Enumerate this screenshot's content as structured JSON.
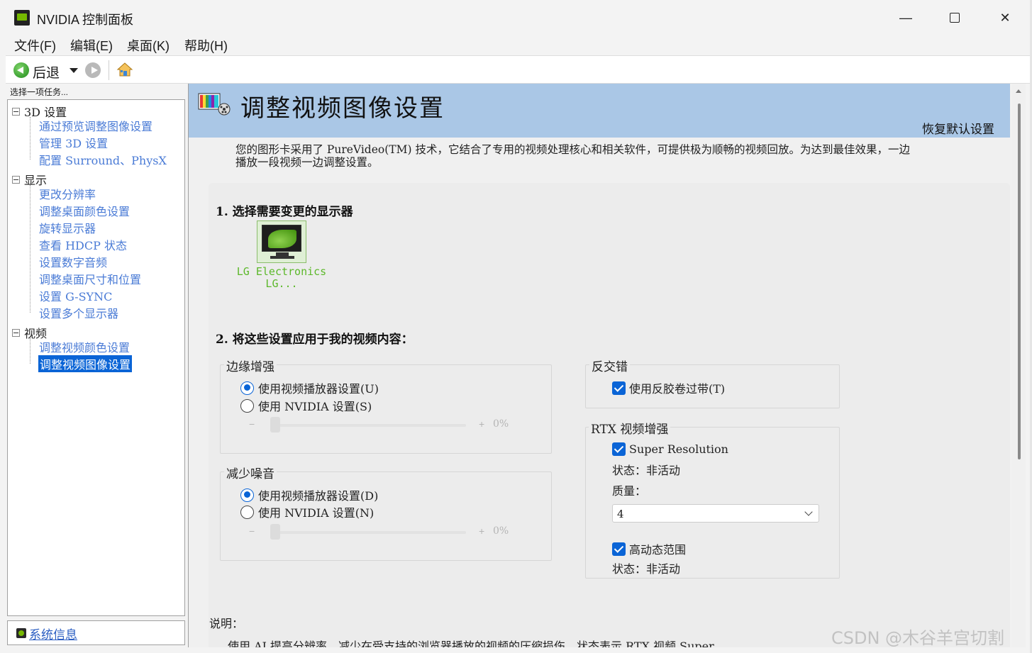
{
  "window": {
    "title": "NVIDIA 控制面板"
  },
  "menu": [
    "文件(F)",
    "编辑(E)",
    "桌面(K)",
    "帮助(H)"
  ],
  "toolbar": {
    "back_label": "后退"
  },
  "sidebar": {
    "caption": "选择一项任务...",
    "groups": [
      {
        "label": "3D 设置",
        "items": [
          "通过预览调整图像设置",
          "管理 3D 设置",
          "配置 Surround、PhysX"
        ]
      },
      {
        "label": "显示",
        "items": [
          "更改分辨率",
          "调整桌面颜色设置",
          "旋转显示器",
          "查看 HDCP 状态",
          "设置数字音频",
          "调整桌面尺寸和位置",
          "设置 G-SYNC",
          "设置多个显示器"
        ]
      },
      {
        "label": "视频",
        "items": [
          "调整视频颜色设置",
          "调整视频图像设置"
        ]
      }
    ],
    "system_info": "系统信息"
  },
  "main": {
    "title": "调整视频图像设置",
    "restore_defaults": "恢复默认设置",
    "intro_line1": "您的图形卡采用了 PureVideo(TM) 技术，它结合了专用的视频处理核心和相关软件，可提供极为顺畅的视频回放。为达到最佳效果，一边",
    "intro_line2": "播放一段视频一边调整设置。",
    "step1": "1.  选择需要变更的显示器",
    "monitor_name_line1": "LG Electronics",
    "monitor_name_line2": "LG...",
    "step2": "2.  将这些设置应用于我的视频内容：",
    "edge": {
      "title": "边缘增强",
      "opt_player": "使用视频播放器设置(U)",
      "opt_nvidia": "使用 NVIDIA 设置(S)",
      "slider_minus": "−",
      "slider_plus": "+",
      "slider_value": "0%"
    },
    "noise": {
      "title": "减少噪音",
      "opt_player": "使用视频播放器设置(D)",
      "opt_nvidia": "使用 NVIDIA 设置(N)",
      "slider_minus": "−",
      "slider_plus": "+",
      "slider_value": "0%"
    },
    "deinterlace": {
      "title": "反交错",
      "inverse_telecine": "使用反胶卷过带(T)"
    },
    "rtx": {
      "title": "RTX 视频增强",
      "super_resolution": "Super Resolution",
      "sr_status": "状态：非活动",
      "quality_label": "质量：",
      "quality_value": "4",
      "hdr": "高动态范围",
      "hdr_status": "状态：非活动"
    },
    "desc_label": "说明：",
    "desc_text": "使用 AI 提高分辨率，减少在受支持的浏览器播放的视频的压缩损伤。状态表示 RTX 视频 Super"
  },
  "watermark": "CSDN @木谷羊宫切割",
  "colors": {
    "accent": "#0a64d6",
    "header_band": "#aac7e6",
    "nvidia_green": "#76b900",
    "link": "#4a7bd6"
  }
}
